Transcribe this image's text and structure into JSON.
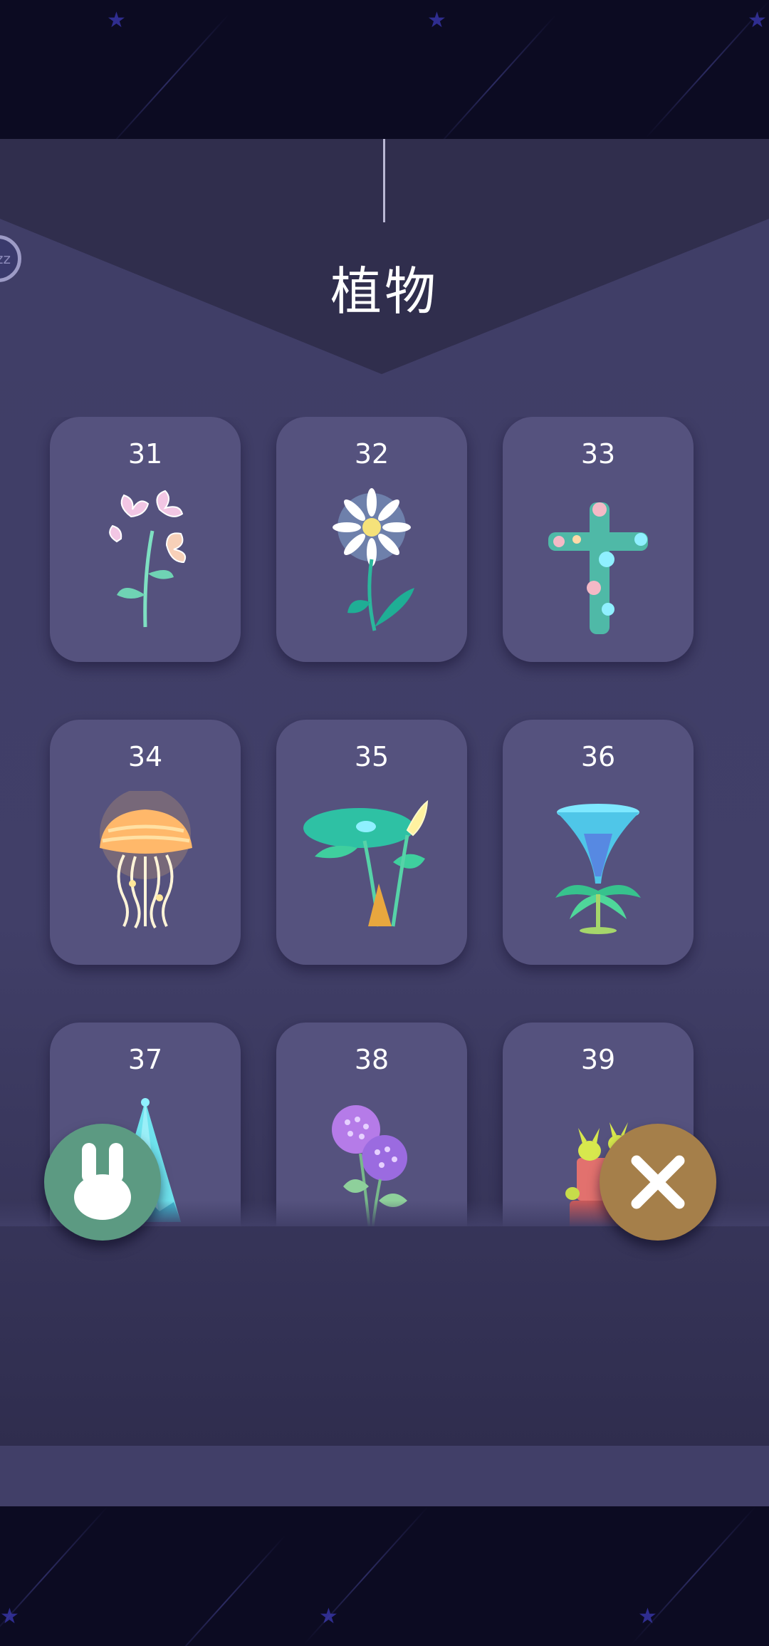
{
  "header": {
    "title": "植物",
    "badge_text": "zz"
  },
  "cards": [
    {
      "number": "31",
      "plant": "pink-sweetpea-flower"
    },
    {
      "number": "32",
      "plant": "glowing-white-daisy"
    },
    {
      "number": "33",
      "plant": "flower-cross-vine"
    },
    {
      "number": "34",
      "plant": "jellyfish-mushroom"
    },
    {
      "number": "35",
      "plant": "lotus-leaf-plant"
    },
    {
      "number": "36",
      "plant": "funnel-palm-plant"
    },
    {
      "number": "37",
      "plant": "ice-crystal-tree"
    },
    {
      "number": "38",
      "plant": "purple-hydrangea"
    },
    {
      "number": "39",
      "plant": "bunny-cactus-pot"
    }
  ],
  "buttons": {
    "left_icon": "bunny-icon",
    "right_icon": "close-icon"
  },
  "colors": {
    "panel": "#413f68",
    "card": "#55527e",
    "bunny_button": "#5c9a82",
    "close_button": "#a57f4a",
    "sky": "#0c0b22"
  }
}
